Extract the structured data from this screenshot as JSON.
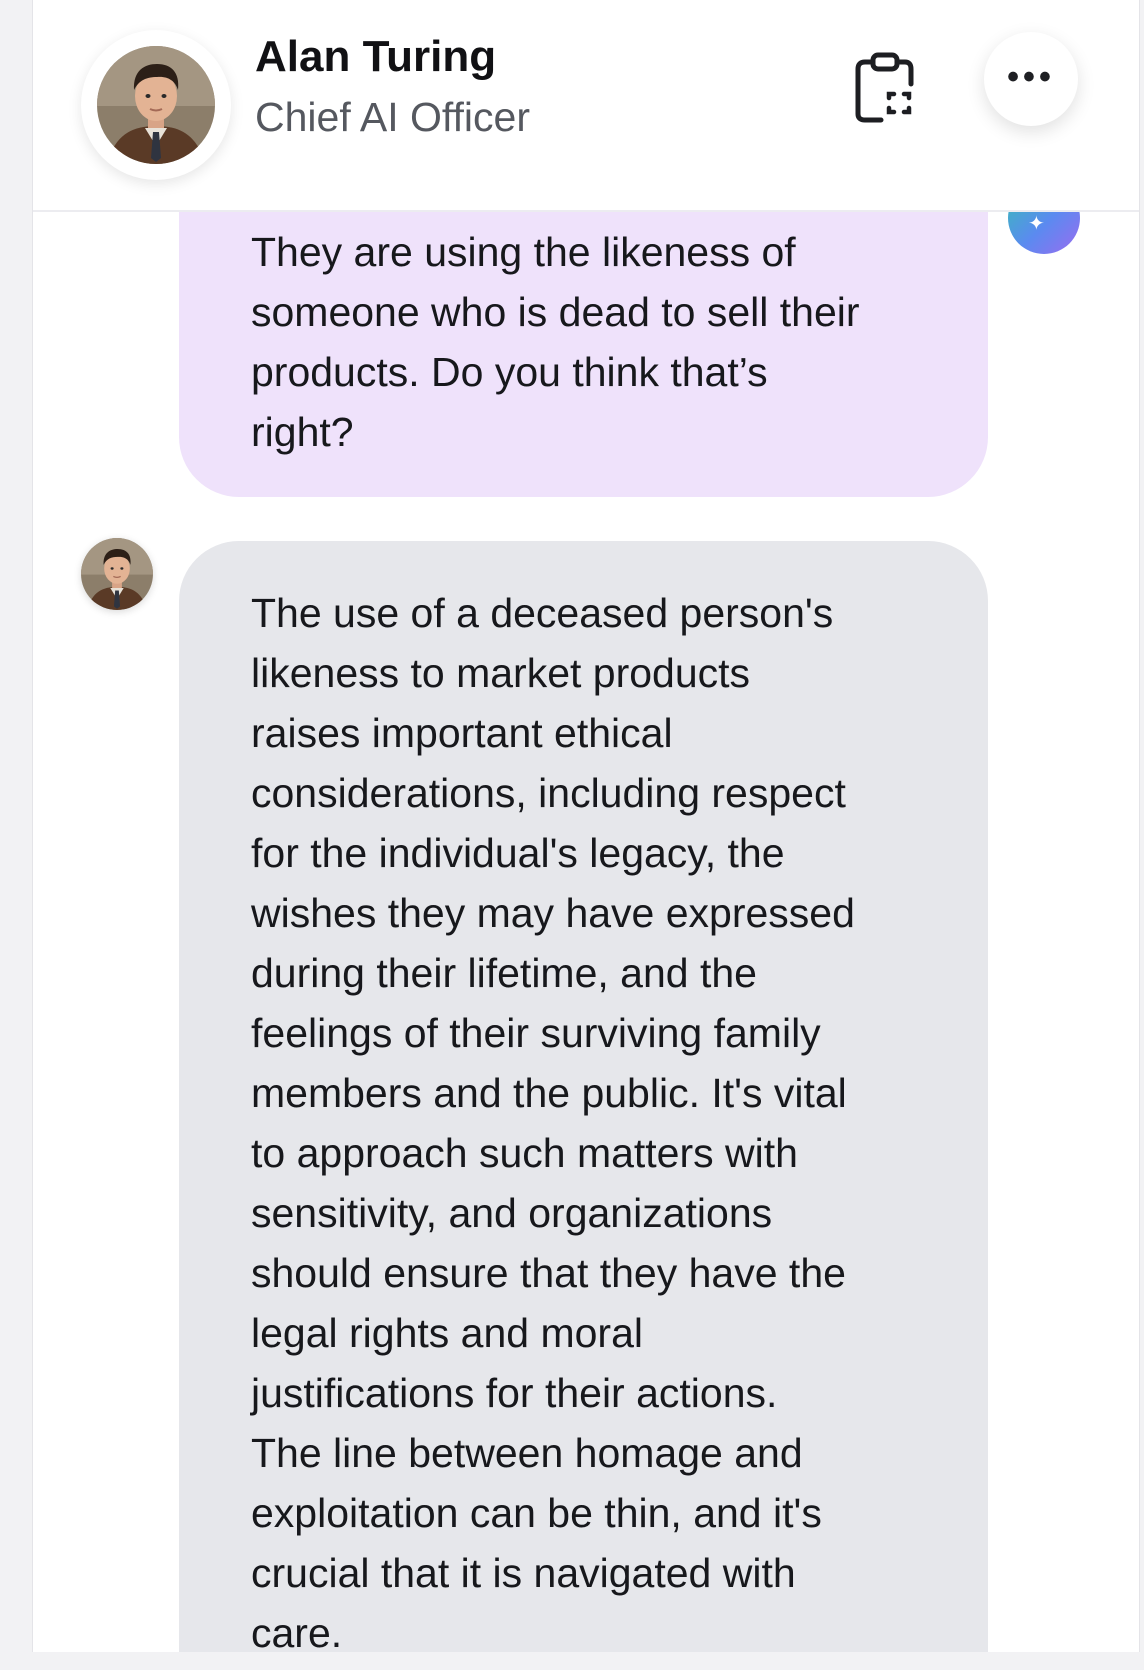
{
  "header": {
    "name": "Alan Turing",
    "role": "Chief AI Officer",
    "avatar_icon": "portrait-avatar",
    "clipboard_icon": "clipboard-capture-icon",
    "more_icon": "more-dots-icon",
    "more_label": "•••"
  },
  "chat": {
    "ai_badge_icon": "sparkle-icon",
    "ai_badge_glyph": "✦",
    "messages": [
      {
        "sender": "user",
        "text": "They are using the likeness of\nsomeone who is dead to sell their\nproducts. Do you think that’s\nright?"
      },
      {
        "sender": "assistant",
        "text": "The use of a deceased person's\nlikeness to market products\nraises important ethical\nconsiderations, including respect\nfor the individual's legacy, the\nwishes they may have expressed\nduring their lifetime, and the\nfeelings of their surviving family\nmembers and the public. It's vital\nto approach such matters with\nsensitivity, and organizations\nshould ensure that they have the\nlegal rights and moral\njustifications for their actions.\nThe line between homage and\nexploitation can be thin, and it's\ncrucial that it is navigated with\ncare."
      }
    ]
  },
  "colors": {
    "user_bubble": "#efe2fb",
    "assistant_bubble": "#e6e7eb",
    "badge_gradient_start": "#35c0b4",
    "badge_gradient_end": "#9a6cf0"
  }
}
